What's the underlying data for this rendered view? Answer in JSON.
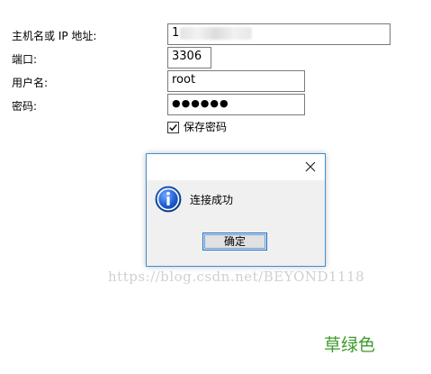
{
  "form": {
    "host_label": "主机名或 IP 地址:",
    "host_value": "1",
    "port_label": "端口:",
    "port_value": "3306",
    "user_label": "用户名:",
    "user_value": "root",
    "password_label": "密码:",
    "password_value": "●●●●●●",
    "save_password_label": "保存密码",
    "save_password_checked": true
  },
  "dialog": {
    "message": "连接成功",
    "ok_label": "确定",
    "icon": "info-icon",
    "border_color": "#3c8fd6"
  },
  "watermark": "https://blog.csdn.net/BEYOND1118",
  "caption": "草绿色",
  "caption_color": "#3d9a2b"
}
